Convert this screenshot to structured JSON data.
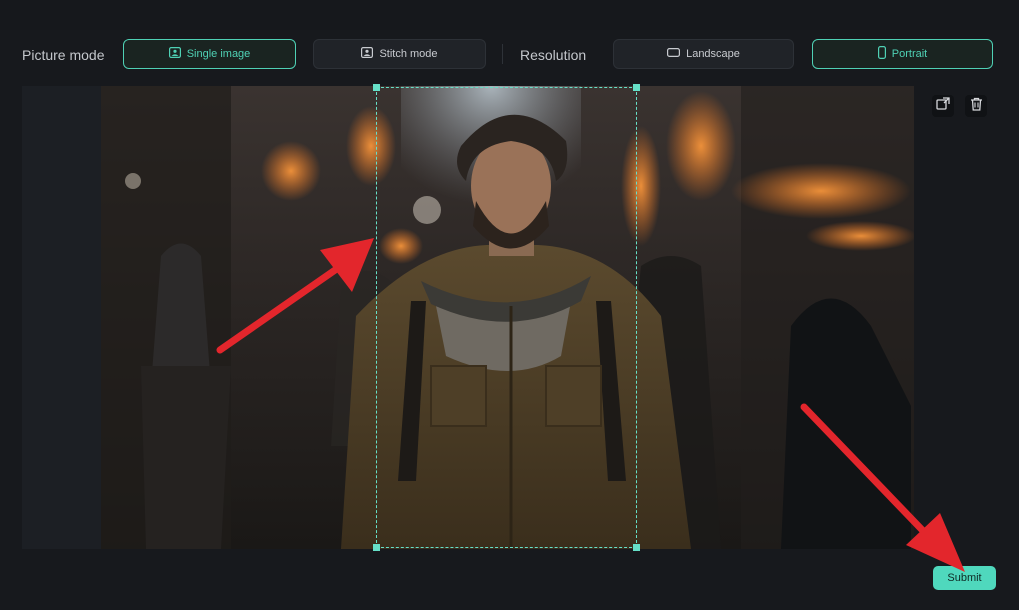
{
  "toolbar": {
    "picture_mode_label": "Picture mode",
    "single_image_label": "Single image",
    "stitch_mode_label": "Stitch mode",
    "resolution_label": "Resolution",
    "landscape_label": "Landscape",
    "portrait_label": "Portrait"
  },
  "icons": {
    "single_image": "image-icon",
    "stitch_mode": "stitch-icon",
    "landscape": "landscape-icon",
    "portrait": "portrait-icon",
    "replace": "replace-image-icon",
    "delete": "trash-icon"
  },
  "colors": {
    "accent": "#4fd1b5",
    "background": "#17191d",
    "arrow": "#e3262c"
  },
  "footer": {
    "submit_label": "Submit"
  }
}
